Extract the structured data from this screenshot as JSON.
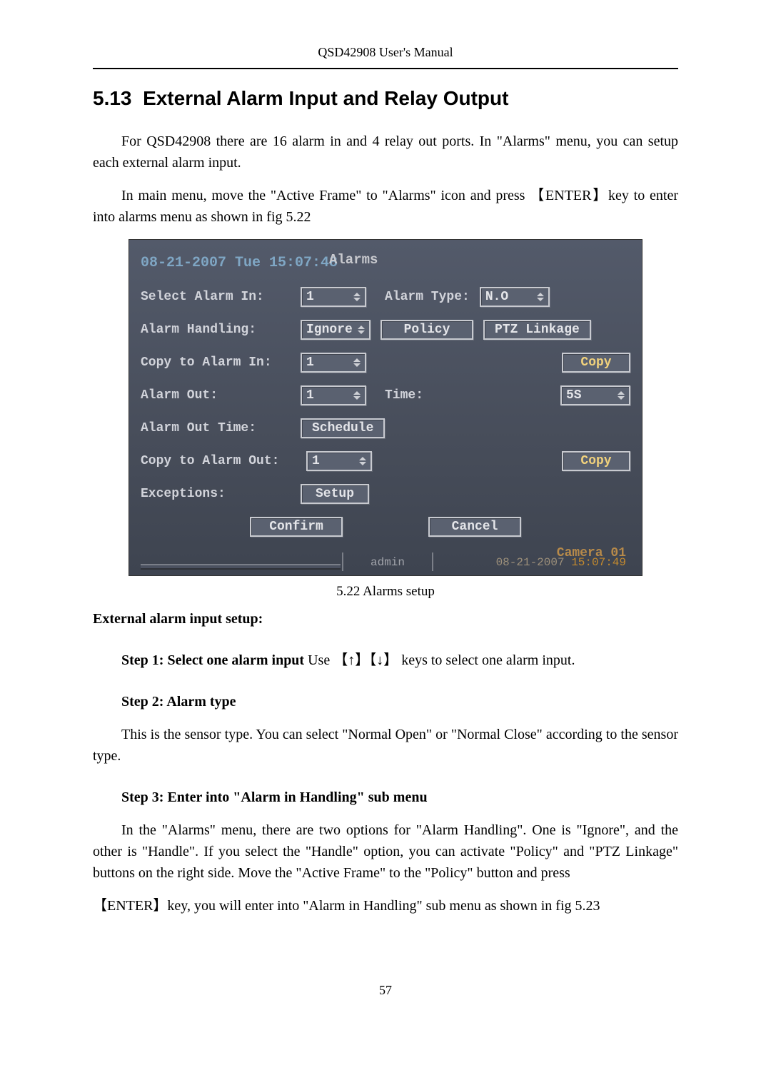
{
  "header": {
    "title": "QSD42908 User's Manual"
  },
  "section": {
    "number": "5.13",
    "title": "External Alarm Input and Relay Output"
  },
  "intro": {
    "p1": "For QSD42908 there are 16 alarm in and 4 relay out ports. In \"Alarms\" menu, you can setup each external alarm input.",
    "p2": "In main menu, move the \"Active Frame\" to \"Alarms\" icon and press 【ENTER】key to enter into alarms menu as shown in fig 5.22"
  },
  "figure": {
    "caption": "5.22 Alarms setup",
    "datetime_line": "08-21-2007 Tue 15:07:48",
    "overlay_title": "Alarms",
    "fields": {
      "select_alarm_in": {
        "label": "Select Alarm In:",
        "value": "1"
      },
      "alarm_type": {
        "label": "Alarm Type:",
        "value": "N.O"
      },
      "alarm_handling": {
        "label": "Alarm Handling:",
        "value": "Ignore"
      },
      "policy_btn": "Policy",
      "ptz_btn": "PTZ Linkage",
      "copy_to_alarm_in": {
        "label": "Copy to Alarm In:",
        "value": "1"
      },
      "copy_btn1": "Copy",
      "alarm_out": {
        "label": "Alarm Out:",
        "value": "1"
      },
      "time": {
        "label": "Time:",
        "value": "5S"
      },
      "alarm_out_time": {
        "label": "Alarm Out Time:",
        "btn": "Schedule"
      },
      "copy_to_alarm_out": {
        "label": "Copy to Alarm Out:",
        "value": "1"
      },
      "copy_btn2": "Copy",
      "exceptions": {
        "label": "Exceptions:",
        "btn": "Setup"
      },
      "confirm": "Confirm",
      "cancel": "Cancel"
    },
    "status": {
      "user": "admin",
      "camera": "Camera 01",
      "date": "08-21-2007",
      "time": "15:07:49"
    }
  },
  "subheading": "External alarm input setup:",
  "steps": {
    "s1_head": "Step 1: Select one alarm input ",
    "s1_tail": "Use 【↑】【↓】 keys to select one alarm input.",
    "s2_head": "Step 2: Alarm type",
    "s2_body": "This is the sensor type. You can select \"Normal Open\" or \"Normal Close\" according to the sensor type.",
    "s3_head": "Step 3: Enter into \"Alarm in Handling\" sub menu",
    "s3_body1": "In the \"Alarms\" menu, there are two options for \"Alarm Handling\".   One is \"Ignore\", and the other is \"Handle\". If you select the \"Handle\" option, you can activate \"Policy\" and \"PTZ Linkage\" buttons on the right side. Move the \"Active Frame\" to the \"Policy\" button and press",
    "s3_body2": "【ENTER】key, you will enter into \"Alarm in Handling\" sub menu as shown in fig 5.23"
  },
  "page_number": "57"
}
